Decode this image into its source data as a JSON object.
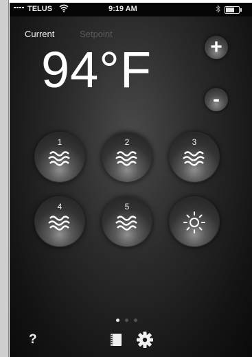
{
  "status_bar": {
    "carrier": "TELUS",
    "time": "9:19 AM"
  },
  "modes": {
    "current_label": "Current",
    "setpoint_label": "Setpoint"
  },
  "temperature": "94°F",
  "controls": {
    "increase_label": "+",
    "decrease_label": "-"
  },
  "jets": [
    {
      "number": "1",
      "icon": "water-waves-icon"
    },
    {
      "number": "2",
      "icon": "water-waves-icon"
    },
    {
      "number": "3",
      "icon": "water-waves-icon"
    },
    {
      "number": "4",
      "icon": "water-waves-icon"
    },
    {
      "number": "5",
      "icon": "water-waves-icon"
    },
    {
      "number": "",
      "icon": "light-sun-icon"
    }
  ],
  "footer": {
    "help_label": "?",
    "page_count": 3,
    "active_page": 1
  },
  "colors": {
    "accent": "#ffffff",
    "inactive_text": "#5a5a5a",
    "background": "#1a1a1a"
  }
}
